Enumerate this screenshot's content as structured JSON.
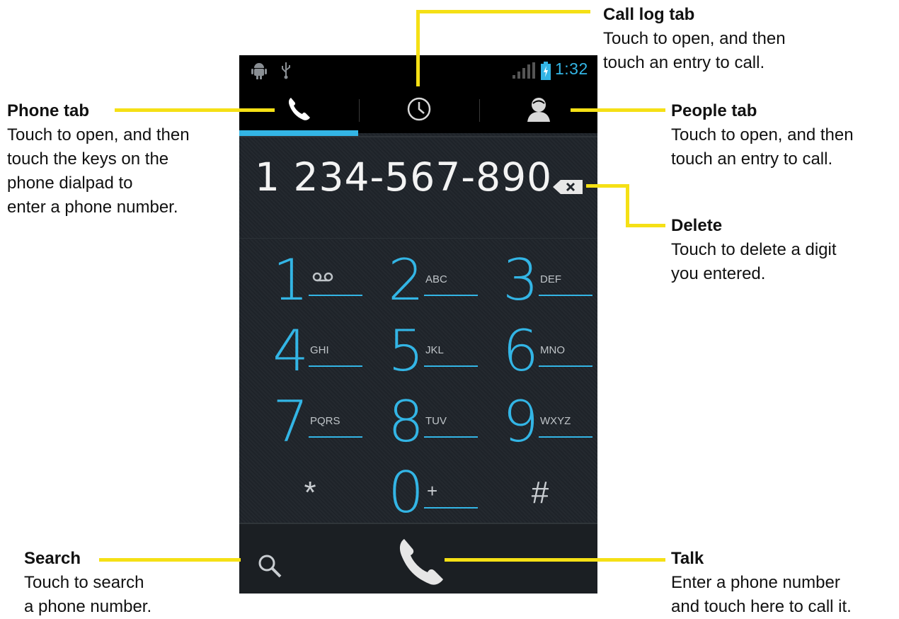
{
  "status_bar": {
    "time": "1:32",
    "icons": [
      "android-debug-icon",
      "usb-icon",
      "signal-icon",
      "battery-icon"
    ]
  },
  "tabs": [
    {
      "name": "phone",
      "icon": "phone-icon",
      "active": true
    },
    {
      "name": "call-log",
      "icon": "clock-icon",
      "active": false
    },
    {
      "name": "people",
      "icon": "person-icon",
      "active": false
    }
  ],
  "dialed_number": "1 234-567-890",
  "keys": [
    {
      "digit": "1",
      "letters": "",
      "icon": "voicemail-icon"
    },
    {
      "digit": "2",
      "letters": "ABC"
    },
    {
      "digit": "3",
      "letters": "DEF"
    },
    {
      "digit": "4",
      "letters": "GHI"
    },
    {
      "digit": "5",
      "letters": "JKL"
    },
    {
      "digit": "6",
      "letters": "MNO"
    },
    {
      "digit": "7",
      "letters": "PQRS"
    },
    {
      "digit": "8",
      "letters": "TUV"
    },
    {
      "digit": "9",
      "letters": "WXYZ"
    },
    {
      "digit": "*",
      "letters": ""
    },
    {
      "digit": "0",
      "letters": "+"
    },
    {
      "digit": "#",
      "letters": ""
    }
  ],
  "annotations": {
    "call_log": {
      "title": "Call log tab",
      "desc": "Touch to open, and then\ntouch an entry to call."
    },
    "phone": {
      "title": "Phone tab",
      "desc": "Touch to open, and then\ntouch the keys on the\nphone dialpad to\nenter a phone number."
    },
    "people": {
      "title": "People tab",
      "desc": "Touch to open, and then\ntouch an entry to call."
    },
    "delete": {
      "title": "Delete",
      "desc": "Touch to delete a digit\nyou entered."
    },
    "search": {
      "title": "Search",
      "desc": "Touch to search\na phone number."
    },
    "talk": {
      "title": "Talk",
      "desc": "Enter a phone number\nand touch here to call it."
    }
  },
  "colors": {
    "accent": "#33b5e5",
    "callout": "#f5e015",
    "phone_bg": "#20252b",
    "bar_bg": "#000000"
  }
}
